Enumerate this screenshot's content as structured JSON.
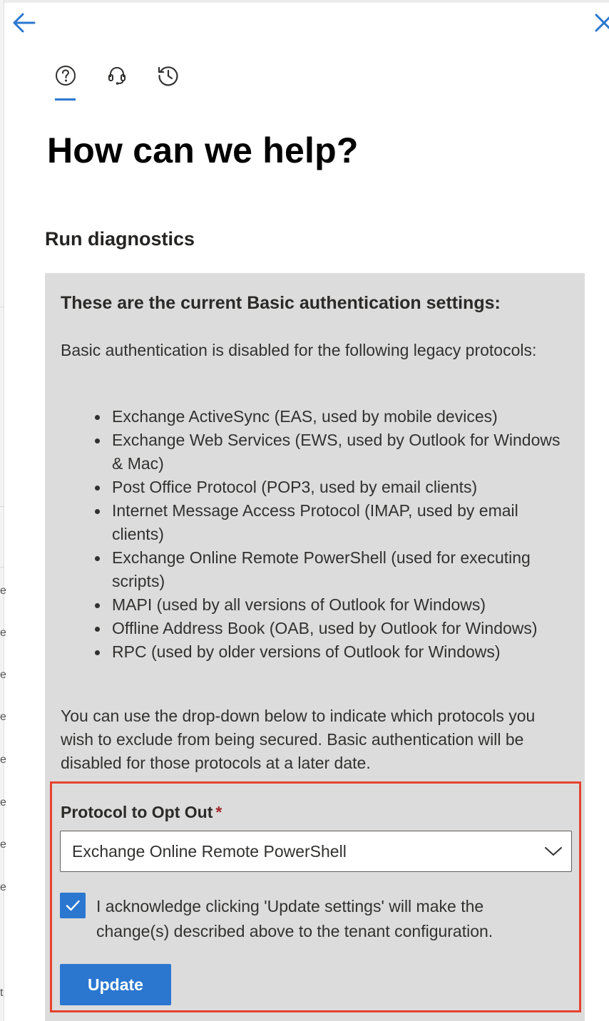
{
  "header": {
    "back_icon": "arrow-left-icon",
    "close_icon": "close-icon"
  },
  "tabs": [
    {
      "icon": "help-circle-icon",
      "active": true
    },
    {
      "icon": "headset-icon",
      "active": false
    },
    {
      "icon": "history-icon",
      "active": false
    }
  ],
  "page": {
    "title": "How can we help?",
    "section_title": "Run diagnostics"
  },
  "diagnostics": {
    "heading": "These are the current Basic authentication settings:",
    "intro": "Basic authentication is disabled for the following legacy protocols:",
    "protocols": [
      "Exchange ActiveSync (EAS, used by mobile devices)",
      "Exchange Web Services (EWS, used by Outlook for Windows & Mac)",
      "Post Office Protocol (POP3, used by email clients)",
      "Internet Message Access Protocol (IMAP, used by email clients)",
      "Exchange Online Remote PowerShell (used for executing scripts)",
      "MAPI (used by all versions of Outlook for Windows)",
      "Offline Address Book (OAB, used by Outlook for Windows)",
      "RPC (used by older versions of Outlook for Windows)"
    ],
    "note": "You can use the drop-down below to indicate which protocols you wish to exclude from being secured. Basic authentication will be disabled for those protocols at a later date."
  },
  "form": {
    "protocol_label": "Protocol to Opt Out",
    "required_marker": "*",
    "protocol_selected": "Exchange Online Remote PowerShell",
    "acknowledge_checked": true,
    "acknowledge_text": "I acknowledge clicking 'Update settings' will make the change(s) described above to the tenant configuration.",
    "update_label": "Update"
  },
  "background_page": {
    "edge_glyphs": [
      "e",
      "e",
      "e",
      "e",
      "e",
      "e",
      "e",
      "e",
      "t"
    ]
  },
  "colors": {
    "accent": "#2b77d0",
    "panel_bg": "#dcdcdc",
    "highlight_border": "#e5432f",
    "required": "#a4262c"
  }
}
